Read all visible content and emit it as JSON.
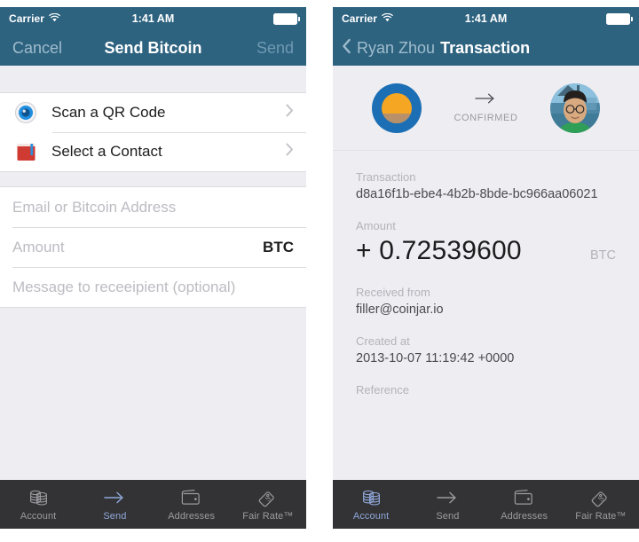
{
  "theme": {
    "header_blue": "#2e6380",
    "screen_bg": "#eeedf1",
    "tabbar_bg": "#333335",
    "tab_active": "#8fa7d8",
    "coin_blue": "#1c6fb5",
    "coin_orange": "#f5a623"
  },
  "status_bar": {
    "carrier": "Carrier",
    "time": "1:41 AM",
    "wifi_icon": "wifi-icon",
    "battery_icon": "battery-icon"
  },
  "send_screen": {
    "nav": {
      "cancel_label": "Cancel",
      "title": "Send Bitcoin",
      "send_label": "Send"
    },
    "actions": [
      {
        "label": "Scan a QR Code",
        "icon": "qr-scan-icon",
        "accessory": "chevron-right-icon"
      },
      {
        "label": "Select a Contact",
        "icon": "address-book-icon",
        "accessory": "chevron-right-icon"
      }
    ],
    "form": {
      "recipient": {
        "placeholder": "Email or Bitcoin Address",
        "value": ""
      },
      "amount": {
        "placeholder": "Amount",
        "value": "",
        "unit": "BTC"
      },
      "message": {
        "placeholder": "Message to receeipient (optional)",
        "value": ""
      }
    }
  },
  "transaction_screen": {
    "nav": {
      "back_icon": "chevron-left-icon",
      "back_label": "Ryan Zhou",
      "title": "Transaction"
    },
    "header": {
      "from_avatar": "coinjar-coin-avatar",
      "arrow_icon": "arrow-right-icon",
      "status": "CONFIRMED",
      "to_avatar": "contact-photo-avatar"
    },
    "fields": [
      {
        "label": "Transaction",
        "value": "d8a16f1b-ebe4-4b2b-8bde-bc966aa06021"
      },
      {
        "label": "Received from",
        "value": "filler@coinjar.io"
      },
      {
        "label": "Created at",
        "value": "2013-10-07 11:19:42 +0000"
      },
      {
        "label": "Reference",
        "value": ""
      }
    ],
    "amount": {
      "label": "Amount",
      "value": "+ 0.72539600",
      "unit": "BTC"
    }
  },
  "tabbar": {
    "items": [
      {
        "label": "Account",
        "icon": "coins-stack-icon"
      },
      {
        "label": "Send",
        "icon": "arrow-right-icon"
      },
      {
        "label": "Addresses",
        "icon": "wallet-icon"
      },
      {
        "label": "Fair Rate™",
        "icon": "price-tag-icon"
      }
    ],
    "active_left": "Send",
    "active_right": "Account"
  }
}
